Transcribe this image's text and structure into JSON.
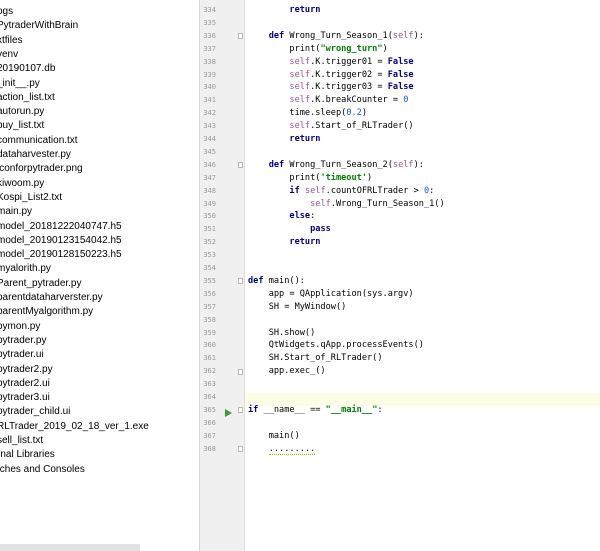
{
  "project_tree": {
    "items": [
      "ogs",
      "PytraderWithBrain",
      "xtfiles",
      "venv",
      "20190107.db",
      "_init__.py",
      "action_list.txt",
      "autorun.py",
      "buy_list.txt",
      "communication.txt",
      "dataharvester.py",
      "iconforpytrader.png",
      "kiwoom.py",
      "Kospi_List2.txt",
      "main.py",
      "model_20181222040747.h5",
      "model_20190123154042.h5",
      "model_20190128150223.h5",
      "myalorith.py",
      "Parent_pytrader.py",
      "parentdataharverster.py",
      "parentMyalgorithm.py",
      "pymon.py",
      "pytrader.py",
      "pytrader.ui",
      "pytrader2.py",
      "pytrader2.ui",
      "pytrader3.ui",
      "pytrader_child.ui",
      "RLTrader_2019_02_18_ver_1.exe",
      "sell_list.txt",
      "rnal Libraries",
      "tches and Consoles"
    ]
  },
  "editor": {
    "line_numbers": [
      "334",
      "335",
      "336",
      "337",
      "338",
      "339",
      "340",
      "341",
      "342",
      "343",
      "344",
      "345",
      "346",
      "347",
      "348",
      "349",
      "350",
      "351",
      "352",
      "353",
      "354",
      "355",
      "356",
      "357",
      "358",
      "359",
      "360",
      "361",
      "362",
      "363",
      "364",
      "365",
      "366",
      "367",
      "368"
    ],
    "lines": [
      {
        "segments": [
          {
            "t": "        ",
            "c": ""
          },
          {
            "t": "return",
            "c": "kw"
          }
        ]
      },
      {
        "segments": [
          {
            "t": "",
            "c": ""
          }
        ]
      },
      {
        "segments": [
          {
            "t": "    ",
            "c": ""
          },
          {
            "t": "def",
            "c": "kw"
          },
          {
            "t": " Wrong_Turn_Season_1(",
            "c": ""
          },
          {
            "t": "self",
            "c": "self"
          },
          {
            "t": "):",
            "c": ""
          }
        ]
      },
      {
        "segments": [
          {
            "t": "        print(",
            "c": ""
          },
          {
            "t": "\"wrong_turn\"",
            "c": "str"
          },
          {
            "t": ")",
            "c": ""
          }
        ]
      },
      {
        "segments": [
          {
            "t": "        ",
            "c": ""
          },
          {
            "t": "self",
            "c": "self"
          },
          {
            "t": ".K.trigger01 = ",
            "c": ""
          },
          {
            "t": "False",
            "c": "kw"
          }
        ]
      },
      {
        "segments": [
          {
            "t": "        ",
            "c": ""
          },
          {
            "t": "self",
            "c": "self"
          },
          {
            "t": ".K.trigger02 = ",
            "c": ""
          },
          {
            "t": "False",
            "c": "kw"
          }
        ]
      },
      {
        "segments": [
          {
            "t": "        ",
            "c": ""
          },
          {
            "t": "self",
            "c": "self"
          },
          {
            "t": ".K.trigger03 = ",
            "c": ""
          },
          {
            "t": "False",
            "c": "kw"
          }
        ]
      },
      {
        "segments": [
          {
            "t": "        ",
            "c": ""
          },
          {
            "t": "self",
            "c": "self"
          },
          {
            "t": ".K.breakCounter = ",
            "c": ""
          },
          {
            "t": "0",
            "c": "num"
          }
        ]
      },
      {
        "segments": [
          {
            "t": "        time.sleep(",
            "c": ""
          },
          {
            "t": "0.2",
            "c": "num"
          },
          {
            "t": ")",
            "c": ""
          }
        ]
      },
      {
        "segments": [
          {
            "t": "        ",
            "c": ""
          },
          {
            "t": "self",
            "c": "self"
          },
          {
            "t": ".Start_of_RLTrader()",
            "c": ""
          }
        ]
      },
      {
        "segments": [
          {
            "t": "        ",
            "c": ""
          },
          {
            "t": "return",
            "c": "kw"
          }
        ]
      },
      {
        "segments": [
          {
            "t": "",
            "c": ""
          }
        ]
      },
      {
        "segments": [
          {
            "t": "    ",
            "c": ""
          },
          {
            "t": "def",
            "c": "kw"
          },
          {
            "t": " Wrong_Turn_Season_2(",
            "c": ""
          },
          {
            "t": "self",
            "c": "self"
          },
          {
            "t": "):",
            "c": ""
          }
        ]
      },
      {
        "segments": [
          {
            "t": "        print(",
            "c": ""
          },
          {
            "t": "'timeout'",
            "c": "str"
          },
          {
            "t": ")",
            "c": ""
          }
        ]
      },
      {
        "segments": [
          {
            "t": "        ",
            "c": ""
          },
          {
            "t": "if",
            "c": "kw"
          },
          {
            "t": " ",
            "c": ""
          },
          {
            "t": "self",
            "c": "self"
          },
          {
            "t": ".countOFRLTrader > ",
            "c": ""
          },
          {
            "t": "0",
            "c": "num"
          },
          {
            "t": ":",
            "c": ""
          }
        ]
      },
      {
        "segments": [
          {
            "t": "            ",
            "c": ""
          },
          {
            "t": "self",
            "c": "self"
          },
          {
            "t": ".Wrong_Turn_Season_1()",
            "c": ""
          }
        ]
      },
      {
        "segments": [
          {
            "t": "        ",
            "c": ""
          },
          {
            "t": "else",
            "c": "kw"
          },
          {
            "t": ":",
            "c": ""
          }
        ]
      },
      {
        "segments": [
          {
            "t": "            ",
            "c": ""
          },
          {
            "t": "pass",
            "c": "kw"
          }
        ]
      },
      {
        "segments": [
          {
            "t": "        ",
            "c": ""
          },
          {
            "t": "return",
            "c": "kw"
          }
        ]
      },
      {
        "segments": [
          {
            "t": "",
            "c": ""
          }
        ]
      },
      {
        "segments": [
          {
            "t": "",
            "c": ""
          }
        ]
      },
      {
        "segments": [
          {
            "t": "def",
            "c": "kw"
          },
          {
            "t": " main():",
            "c": ""
          }
        ]
      },
      {
        "segments": [
          {
            "t": "    app = QApplication(sys.argv)",
            "c": ""
          }
        ]
      },
      {
        "segments": [
          {
            "t": "    SH = MyWindow()",
            "c": ""
          }
        ]
      },
      {
        "segments": [
          {
            "t": "",
            "c": ""
          }
        ]
      },
      {
        "segments": [
          {
            "t": "    SH.show()",
            "c": ""
          }
        ]
      },
      {
        "segments": [
          {
            "t": "    QtWidgets.qApp.processEvents()",
            "c": ""
          }
        ]
      },
      {
        "segments": [
          {
            "t": "    SH.Start_of_RLTrader()",
            "c": ""
          }
        ]
      },
      {
        "segments": [
          {
            "t": "    app.exec_()",
            "c": ""
          }
        ]
      },
      {
        "segments": [
          {
            "t": "",
            "c": ""
          }
        ]
      },
      {
        "segments": [
          {
            "t": "",
            "c": ""
          }
        ]
      },
      {
        "segments": [
          {
            "t": "if",
            "c": "kw"
          },
          {
            "t": " __name__ == ",
            "c": ""
          },
          {
            "t": "\"__main__\"",
            "c": "str"
          },
          {
            "t": ":",
            "c": ""
          }
        ]
      },
      {
        "segments": [
          {
            "t": "",
            "c": ""
          }
        ]
      },
      {
        "segments": [
          {
            "t": "    main()",
            "c": ""
          }
        ]
      },
      {
        "segments": [
          {
            "t": "    ",
            "c": ""
          },
          {
            "t": ".........",
            "c": "wavy"
          }
        ]
      }
    ]
  }
}
